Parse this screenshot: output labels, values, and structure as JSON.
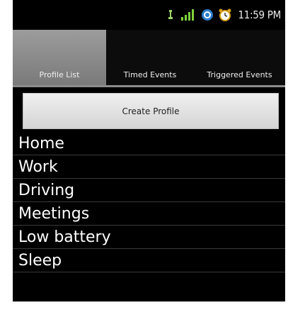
{
  "status_bar": {
    "time": "11:59 PM",
    "icons": [
      "usb-icon",
      "signal-icon",
      "sync-icon",
      "alarm-icon"
    ]
  },
  "tabs": [
    {
      "label": "Profile List",
      "selected": true
    },
    {
      "label": "Timed Events",
      "selected": false
    },
    {
      "label": "Triggered Events",
      "selected": false
    }
  ],
  "create_button": {
    "label": "Create Profile"
  },
  "profiles": [
    {
      "label": "Home"
    },
    {
      "label": "Work"
    },
    {
      "label": "Driving"
    },
    {
      "label": "Meetings"
    },
    {
      "label": "Low battery"
    },
    {
      "label": "Sleep"
    }
  ],
  "colors": {
    "background": "#000000",
    "tab_selected": "#8a8a8a",
    "button_bg": "#e2e2e2",
    "text": "#ffffff"
  }
}
